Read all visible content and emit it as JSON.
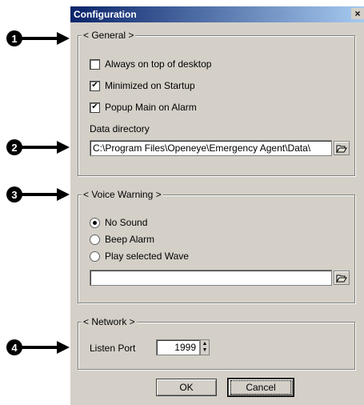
{
  "callouts": [
    "1",
    "2",
    "3",
    "4"
  ],
  "window": {
    "title": "Configuration",
    "close_glyph": "×"
  },
  "general": {
    "legend": "< General >",
    "options": [
      {
        "label": "Always on top of desktop",
        "checked": false
      },
      {
        "label": "Minimized on Startup",
        "checked": true
      },
      {
        "label": "Popup Main on Alarm",
        "checked": true
      }
    ],
    "data_directory_label": "Data directory",
    "data_directory_value": "C:\\Program Files\\Openeye\\Emergency Agent\\Data\\"
  },
  "voice": {
    "legend": "< Voice Warning >",
    "options": [
      {
        "label": "No Sound",
        "selected": true
      },
      {
        "label": "Beep Alarm",
        "selected": false
      },
      {
        "label": "Play selected Wave",
        "selected": false
      }
    ],
    "wave_value": ""
  },
  "network": {
    "legend": "< Network >",
    "listen_port_label": "Listen Port",
    "listen_port_value": "1999"
  },
  "buttons": {
    "ok": "OK",
    "cancel": "Cancel"
  },
  "icons": {
    "browse": "folder-open-icon",
    "check": "✔"
  }
}
